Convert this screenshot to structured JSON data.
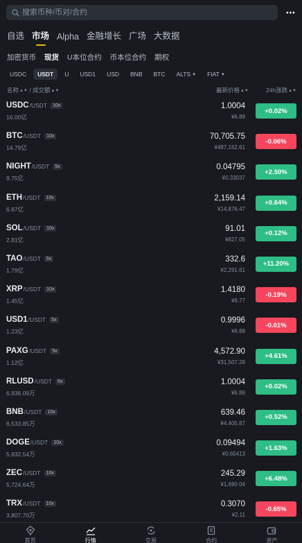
{
  "search": {
    "placeholder": "搜索币种/币对/合约",
    "icon": "search-icon"
  },
  "more_icon": "more-dots-icon",
  "main_tabs": [
    {
      "label": "自选",
      "active": false
    },
    {
      "label": "市场",
      "active": true
    },
    {
      "label": "Alpha",
      "active": false
    },
    {
      "label": "金融增长",
      "active": false
    },
    {
      "label": "广场",
      "active": false
    },
    {
      "label": "大数据",
      "active": false
    }
  ],
  "sub_tabs": [
    {
      "label": "加密货币",
      "active": false
    },
    {
      "label": "现货",
      "active": true
    },
    {
      "label": "U本位合约",
      "active": false
    },
    {
      "label": "币本位合约",
      "active": false
    },
    {
      "label": "期权",
      "active": false
    }
  ],
  "chips": [
    {
      "label": "USDC",
      "active": false,
      "dropdown": false
    },
    {
      "label": "USDT",
      "active": true,
      "dropdown": false
    },
    {
      "label": "U",
      "active": false,
      "dropdown": false
    },
    {
      "label": "USD1",
      "active": false,
      "dropdown": false
    },
    {
      "label": "USD",
      "active": false,
      "dropdown": false
    },
    {
      "label": "BNB",
      "active": false,
      "dropdown": false
    },
    {
      "label": "BTC",
      "active": false,
      "dropdown": false
    },
    {
      "label": "ALTS",
      "active": false,
      "dropdown": true
    },
    {
      "label": "FIAT",
      "active": false,
      "dropdown": true
    }
  ],
  "columns": {
    "name": "名称",
    "sep": " / ",
    "volume": "成交额",
    "price": "最新价格",
    "change": "24h涨跌"
  },
  "colors": {
    "up": "#2ebd85",
    "down": "#f6465d",
    "accent": "#f0b90b",
    "bg": "#181a20"
  },
  "rows": [
    {
      "base": "USDC",
      "quote": "/USDT",
      "lev": "10x",
      "vol": "16.00亿",
      "price": "1.0004",
      "fiat": "¥6.89",
      "change": "+0.02%",
      "dir": "up"
    },
    {
      "base": "BTC",
      "quote": "/USDT",
      "lev": "10x",
      "vol": "14.79亿",
      "price": "70,705.75",
      "fiat": "¥487,162.61",
      "change": "-0.06%",
      "dir": "down"
    },
    {
      "base": "NIGHT",
      "quote": "/USDT",
      "lev": "5x",
      "vol": "9.75亿",
      "price": "0.04795",
      "fiat": "¥0.33037",
      "change": "+2.50%",
      "dir": "up"
    },
    {
      "base": "ETH",
      "quote": "/USDT",
      "lev": "10x",
      "vol": "6.87亿",
      "price": "2,159.14",
      "fiat": "¥14,876.47",
      "change": "+0.64%",
      "dir": "up"
    },
    {
      "base": "SOL",
      "quote": "/USDT",
      "lev": "10x",
      "vol": "2.81亿",
      "price": "91.01",
      "fiat": "¥627.05",
      "change": "+0.12%",
      "dir": "up"
    },
    {
      "base": "TAO",
      "quote": "/USDT",
      "lev": "5x",
      "vol": "1.79亿",
      "price": "332.6",
      "fiat": "¥2,291.61",
      "change": "+11.20%",
      "dir": "up"
    },
    {
      "base": "XRP",
      "quote": "/USDT",
      "lev": "10x",
      "vol": "1.45亿",
      "price": "1.4180",
      "fiat": "¥9.77",
      "change": "-0.19%",
      "dir": "down"
    },
    {
      "base": "USD1",
      "quote": "/USDT",
      "lev": "5x",
      "vol": "1.23亿",
      "price": "0.9996",
      "fiat": "¥6.88",
      "change": "-0.01%",
      "dir": "down"
    },
    {
      "base": "PAXG",
      "quote": "/USDT",
      "lev": "5x",
      "vol": "1.12亿",
      "price": "4,572.90",
      "fiat": "¥31,507.28",
      "change": "+4.61%",
      "dir": "up"
    },
    {
      "base": "RLUSD",
      "quote": "/USDT",
      "lev": "5x",
      "vol": "6,836.09万",
      "price": "1.0004",
      "fiat": "¥6.89",
      "change": "+0.02%",
      "dir": "up"
    },
    {
      "base": "BNB",
      "quote": "/USDT",
      "lev": "10x",
      "vol": "6,533.85万",
      "price": "639.46",
      "fiat": "¥4,405.87",
      "change": "+0.52%",
      "dir": "up"
    },
    {
      "base": "DOGE",
      "quote": "/USDT",
      "lev": "10x",
      "vol": "5,832.54万",
      "price": "0.09494",
      "fiat": "¥0.65413",
      "change": "+1.63%",
      "dir": "up"
    },
    {
      "base": "ZEC",
      "quote": "/USDT",
      "lev": "10x",
      "vol": "5,724.64万",
      "price": "245.29",
      "fiat": "¥1,690.04",
      "change": "+6.48%",
      "dir": "up"
    },
    {
      "base": "TRX",
      "quote": "/USDT",
      "lev": "10x",
      "vol": "3,807.70万",
      "price": "0.3070",
      "fiat": "¥2.11",
      "change": "-0.65%",
      "dir": "down"
    }
  ],
  "bottom_nav": [
    {
      "label": "首页",
      "icon": "home-icon",
      "active": false
    },
    {
      "label": "行情",
      "icon": "markets-chart-icon",
      "active": true
    },
    {
      "label": "交易",
      "icon": "trade-swap-icon",
      "active": false
    },
    {
      "label": "合约",
      "icon": "futures-icon",
      "active": false
    },
    {
      "label": "资产",
      "icon": "wallet-icon",
      "active": false
    }
  ]
}
